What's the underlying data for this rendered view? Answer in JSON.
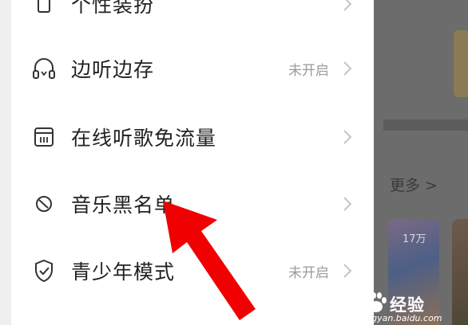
{
  "menu": {
    "items": [
      {
        "label": "个性装扮",
        "status": "",
        "icon": "shirt-icon"
      },
      {
        "label": "边听边存",
        "status": "未开启",
        "icon": "headphones-icon"
      },
      {
        "label": "在线听歌免流量",
        "status": "",
        "icon": "sim-card-icon"
      },
      {
        "label": "音乐黑名单",
        "status": "",
        "icon": "block-icon"
      },
      {
        "label": "青少年模式",
        "status": "未开启",
        "icon": "shield-check-icon"
      }
    ]
  },
  "background": {
    "more_label": "更多 >",
    "play_count": "17万"
  },
  "annotation": {
    "color": "#f00000",
    "icon": "red-arrow-pointer"
  },
  "watermark": {
    "brand": "经验",
    "url": "jingyan.baidu.com",
    "icon": "baidu-paw-icon"
  }
}
